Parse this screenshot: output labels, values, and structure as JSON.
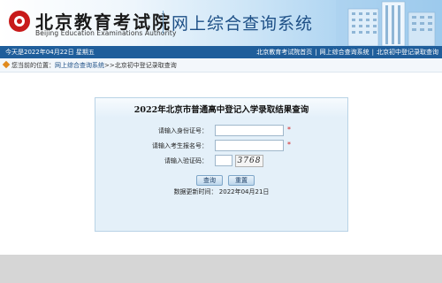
{
  "header": {
    "org_name_cn": "北京教育考试院",
    "org_name_en": "Beijing Education Examinations Authority",
    "system_name": "网上综合查询系统"
  },
  "topnav": {
    "date_text": "今天是2022年04月22日 星期五",
    "links": [
      "北京教育考试院首页",
      "网上综合查询系统",
      "北京初中登记录取查询"
    ],
    "separator": "|"
  },
  "breadcrumb": {
    "prefix": "您当前的位置：",
    "link": "网上综合查询系统",
    "rest": ">>北京初中登记录取查询"
  },
  "panel": {
    "title": "2022年北京市普通高中登记入学录取结果查询",
    "fields": {
      "id_label": "请输入身份证号：",
      "id_value": "",
      "exam_label": "请输入考生报名号：",
      "exam_value": "",
      "captcha_label": "请输入验证码：",
      "captcha_value": "",
      "captcha_image_text": "3768",
      "required_mark": "*"
    },
    "buttons": {
      "query": "查询",
      "reset": "重置"
    },
    "update_text": "数据更新时间： 2022年04月21日"
  },
  "colors": {
    "nav_blue": "#1f5e9b",
    "panel_bg": "#e4f0f9",
    "required_red": "#d22222",
    "logo_red": "#c81a1a"
  }
}
